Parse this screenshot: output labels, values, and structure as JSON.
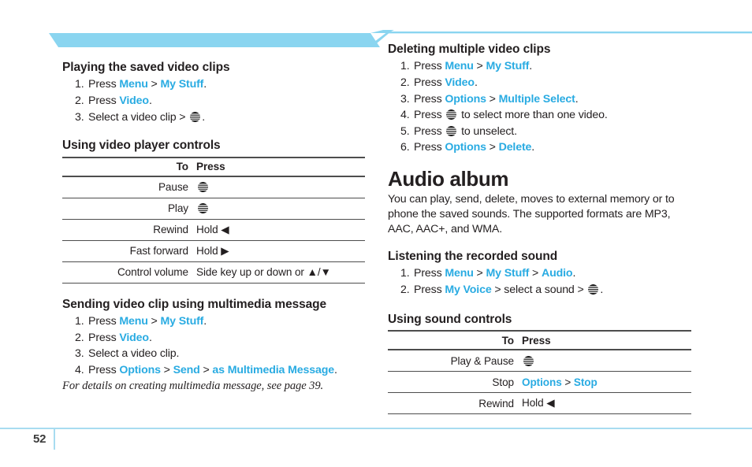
{
  "page": {
    "number": "52",
    "accent_color": "#29abe2",
    "banner_color": "#8ad5f0",
    "footer_rule_color": "#a8dcf0",
    "rule_color": "#4d4d4d",
    "text_color": "#231f20"
  },
  "icons": {
    "globe": "att-globe-icon"
  },
  "left_column": {
    "section1": {
      "title": "Playing the saved video clips",
      "steps": [
        {
          "n": "1.",
          "parts": [
            {
              "t": "Press ",
              "k": false
            },
            {
              "t": "Menu",
              "k": true
            },
            {
              "t": " > ",
              "k": false,
              "sep": true
            },
            {
              "t": "My Stuff",
              "k": true
            },
            {
              "t": ".",
              "k": false
            }
          ]
        },
        {
          "n": "2.",
          "parts": [
            {
              "t": "Press ",
              "k": false
            },
            {
              "t": "Video",
              "k": true
            },
            {
              "t": ".",
              "k": false
            }
          ]
        },
        {
          "n": "3.",
          "parts": [
            {
              "t": "Select a video clip > ",
              "k": false
            },
            {
              "icon": "globe"
            },
            {
              "t": ".",
              "k": false
            }
          ]
        }
      ]
    },
    "section2": {
      "title": "Using video player controls",
      "table": {
        "headers": [
          "To",
          "Press"
        ],
        "rows": [
          {
            "to": "Pause",
            "press_parts": [
              {
                "icon": "globe"
              }
            ]
          },
          {
            "to": "Play",
            "press_parts": [
              {
                "icon": "globe"
              }
            ]
          },
          {
            "to": "Rewind",
            "press_parts": [
              {
                "t": "Hold ◀",
                "k": false
              }
            ]
          },
          {
            "to": "Fast forward",
            "press_parts": [
              {
                "t": "Hold ▶",
                "k": false
              }
            ]
          },
          {
            "to": "Control volume",
            "press_parts": [
              {
                "t": "Side key up or down or ▲/▼",
                "k": false
              }
            ]
          }
        ]
      }
    },
    "section3": {
      "title": "Sending video clip using multimedia message",
      "steps": [
        {
          "n": "1.",
          "parts": [
            {
              "t": "Press ",
              "k": false
            },
            {
              "t": "Menu",
              "k": true
            },
            {
              "t": " > ",
              "k": false,
              "sep": true
            },
            {
              "t": "My Stuff",
              "k": true
            },
            {
              "t": ".",
              "k": false
            }
          ]
        },
        {
          "n": "2.",
          "parts": [
            {
              "t": "Press ",
              "k": false
            },
            {
              "t": "Video",
              "k": true
            },
            {
              "t": ".",
              "k": false
            }
          ]
        },
        {
          "n": "3.",
          "parts": [
            {
              "t": "Select a video clip.",
              "k": false
            }
          ]
        },
        {
          "n": "4.",
          "parts": [
            {
              "t": "Press ",
              "k": false
            },
            {
              "t": "Options",
              "k": true
            },
            {
              "t": " > ",
              "k": false,
              "sep": true
            },
            {
              "t": "Send",
              "k": true
            },
            {
              "t": " > ",
              "k": false,
              "sep": true
            },
            {
              "t": "as Multimedia Message",
              "k": true
            },
            {
              "t": ".",
              "k": false
            }
          ]
        }
      ],
      "note": "For details on creating multimedia message, see page 39."
    }
  },
  "right_column": {
    "section1": {
      "title": "Deleting multiple video clips",
      "steps": [
        {
          "n": "1.",
          "parts": [
            {
              "t": "Press ",
              "k": false
            },
            {
              "t": "Menu",
              "k": true
            },
            {
              "t": " > ",
              "k": false,
              "sep": true
            },
            {
              "t": "My Stuff",
              "k": true
            },
            {
              "t": ".",
              "k": false
            }
          ]
        },
        {
          "n": "2.",
          "parts": [
            {
              "t": "Press ",
              "k": false
            },
            {
              "t": "Video",
              "k": true
            },
            {
              "t": ".",
              "k": false
            }
          ]
        },
        {
          "n": "3.",
          "parts": [
            {
              "t": "Press ",
              "k": false
            },
            {
              "t": "Options",
              "k": true
            },
            {
              "t": " > ",
              "k": false,
              "sep": true
            },
            {
              "t": "Multiple Select",
              "k": true
            },
            {
              "t": ".",
              "k": false
            }
          ]
        },
        {
          "n": "4.",
          "parts": [
            {
              "t": "Press ",
              "k": false
            },
            {
              "icon": "globe"
            },
            {
              "t": " to select more than one video.",
              "k": false
            }
          ]
        },
        {
          "n": "5.",
          "parts": [
            {
              "t": "Press ",
              "k": false
            },
            {
              "icon": "globe"
            },
            {
              "t": " to unselect.",
              "k": false
            }
          ]
        },
        {
          "n": "6.",
          "parts": [
            {
              "t": "Press ",
              "k": false
            },
            {
              "t": "Options",
              "k": true
            },
            {
              "t": " > ",
              "k": false,
              "sep": true
            },
            {
              "t": "Delete",
              "k": true
            },
            {
              "t": ".",
              "k": false
            }
          ]
        }
      ]
    },
    "section2": {
      "title": "Audio album",
      "intro": "You can play, send, delete, moves to external memory or to phone the saved sounds. The supported formats are MP3, AAC, AAC+, and WMA."
    },
    "section3": {
      "title": "Listening the recorded sound",
      "steps": [
        {
          "n": "1.",
          "parts": [
            {
              "t": "Press ",
              "k": false
            },
            {
              "t": "Menu",
              "k": true
            },
            {
              "t": " > ",
              "k": false,
              "sep": true
            },
            {
              "t": "My Stuff",
              "k": true
            },
            {
              "t": " > ",
              "k": false,
              "sep": true
            },
            {
              "t": "Audio",
              "k": true
            },
            {
              "t": ".",
              "k": false
            }
          ]
        },
        {
          "n": "2.",
          "parts": [
            {
              "t": "Press ",
              "k": false
            },
            {
              "t": "My Voice",
              "k": true
            },
            {
              "t": " > select a sound > ",
              "k": false
            },
            {
              "icon": "globe"
            },
            {
              "t": ".",
              "k": false
            }
          ]
        }
      ]
    },
    "section4": {
      "title": "Using sound controls",
      "table": {
        "headers": [
          "To",
          "Press"
        ],
        "rows": [
          {
            "to": "Play & Pause",
            "press_parts": [
              {
                "icon": "globe"
              }
            ]
          },
          {
            "to": "Stop",
            "press_parts": [
              {
                "t": "Options",
                "k": true
              },
              {
                "t": " > ",
                "k": false,
                "sep": true
              },
              {
                "t": "Stop",
                "k": true
              }
            ]
          },
          {
            "to": "Rewind",
            "press_parts": [
              {
                "t": "Hold ◀",
                "k": false
              }
            ]
          }
        ]
      }
    }
  }
}
